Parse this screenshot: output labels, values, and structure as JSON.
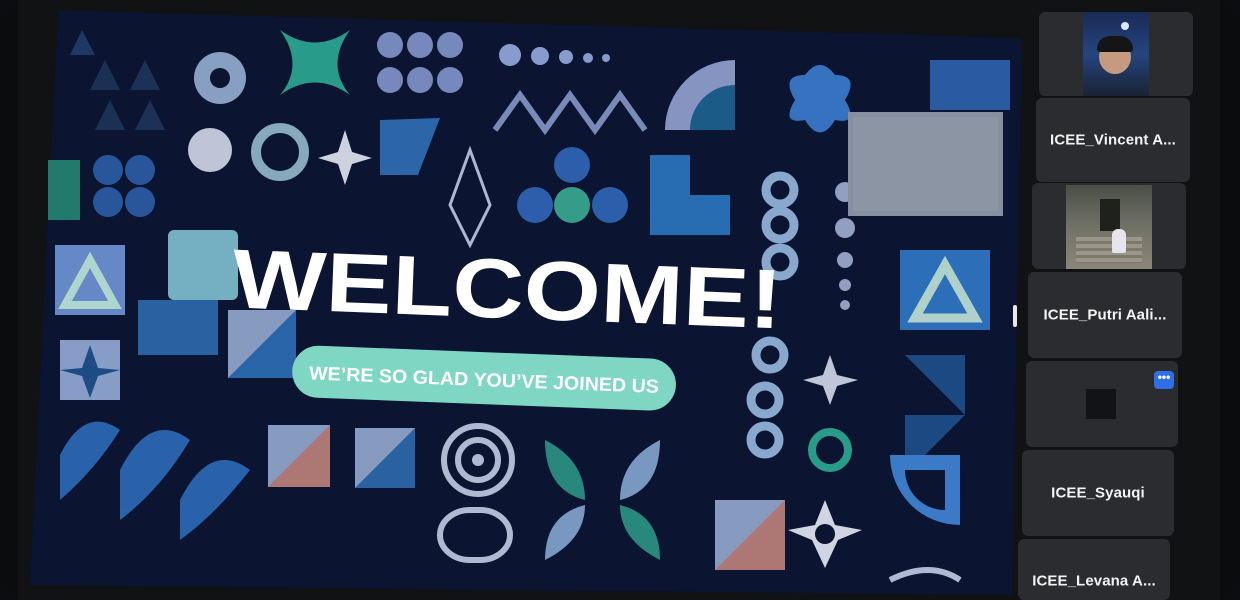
{
  "slide": {
    "headline": "WELCOME!",
    "tagline": "WE’RE SO GLAD YOU’VE JOINED US"
  },
  "participants": [
    {
      "name": "",
      "video": "person-selfie"
    },
    {
      "name": "ICEE_Vincent A..."
    },
    {
      "name": "",
      "video": "temple-photo"
    },
    {
      "name": "ICEE_Putri Aali..."
    },
    {
      "name": "",
      "video": "dark-square"
    },
    {
      "name": "ICEE_Syauqi"
    },
    {
      "name": "ICEE_Levana A..."
    }
  ],
  "icons": {
    "more": "more-options-icon"
  },
  "colors": {
    "accent": "#7fd6c2",
    "background": "#0b1430",
    "tile": "#2a2c30",
    "button": "#2f6ee6"
  }
}
